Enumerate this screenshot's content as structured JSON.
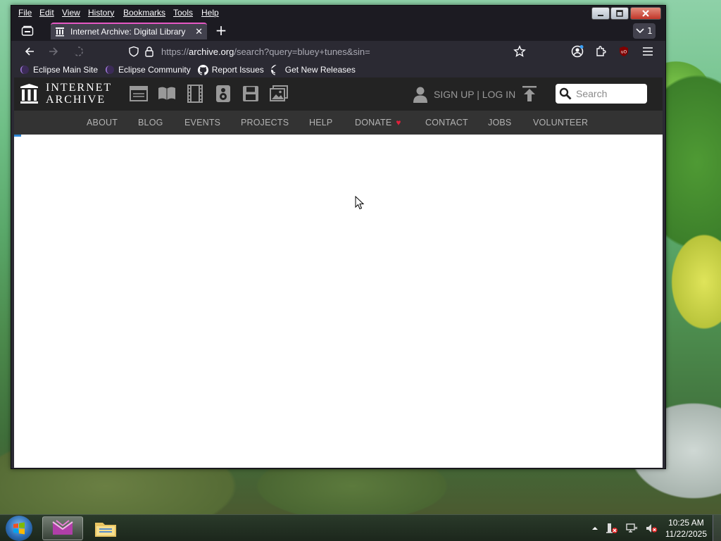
{
  "browser": {
    "menu": [
      "File",
      "Edit",
      "View",
      "History",
      "Bookmarks",
      "Tools",
      "Help"
    ],
    "window_controls": {
      "minimize": "minimize-icon",
      "maximize": "maximize-icon",
      "close": "close-icon"
    },
    "tab": {
      "title": "Internet Archive: Digital Library",
      "favicon": "archive-icon"
    },
    "tab_count": "1",
    "url": {
      "prefix": "https://",
      "domain": "archive.org",
      "path": "/search?query=bluey+tunes&sin="
    },
    "bookmarks": [
      {
        "label": "Eclipse Main Site",
        "icon": "eclipse-icon"
      },
      {
        "label": "Eclipse Community",
        "icon": "eclipse-icon"
      },
      {
        "label": "Report Issues",
        "icon": "github-icon"
      },
      {
        "label": "Get New Releases",
        "icon": "github-icon"
      }
    ],
    "accent": "#e557c4"
  },
  "site": {
    "logo": {
      "line1": "INTERNET",
      "line2": "ARCHIVE"
    },
    "media_icons": [
      "web-icon",
      "texts-icon",
      "video-icon",
      "audio-icon",
      "software-icon",
      "images-icon"
    ],
    "auth": "SIGN UP | LOG IN",
    "search_placeholder": "Search",
    "subnav": [
      "ABOUT",
      "BLOG",
      "EVENTS",
      "PROJECTS",
      "HELP",
      "DONATE",
      "CONTACT",
      "JOBS",
      "VOLUNTEER"
    ],
    "donate_heart_color": "#e3203b"
  },
  "taskbar": {
    "time": "10:25 AM",
    "date": "11/22/2025",
    "apps": [
      "browser-app-icon",
      "file-explorer-icon"
    ]
  }
}
